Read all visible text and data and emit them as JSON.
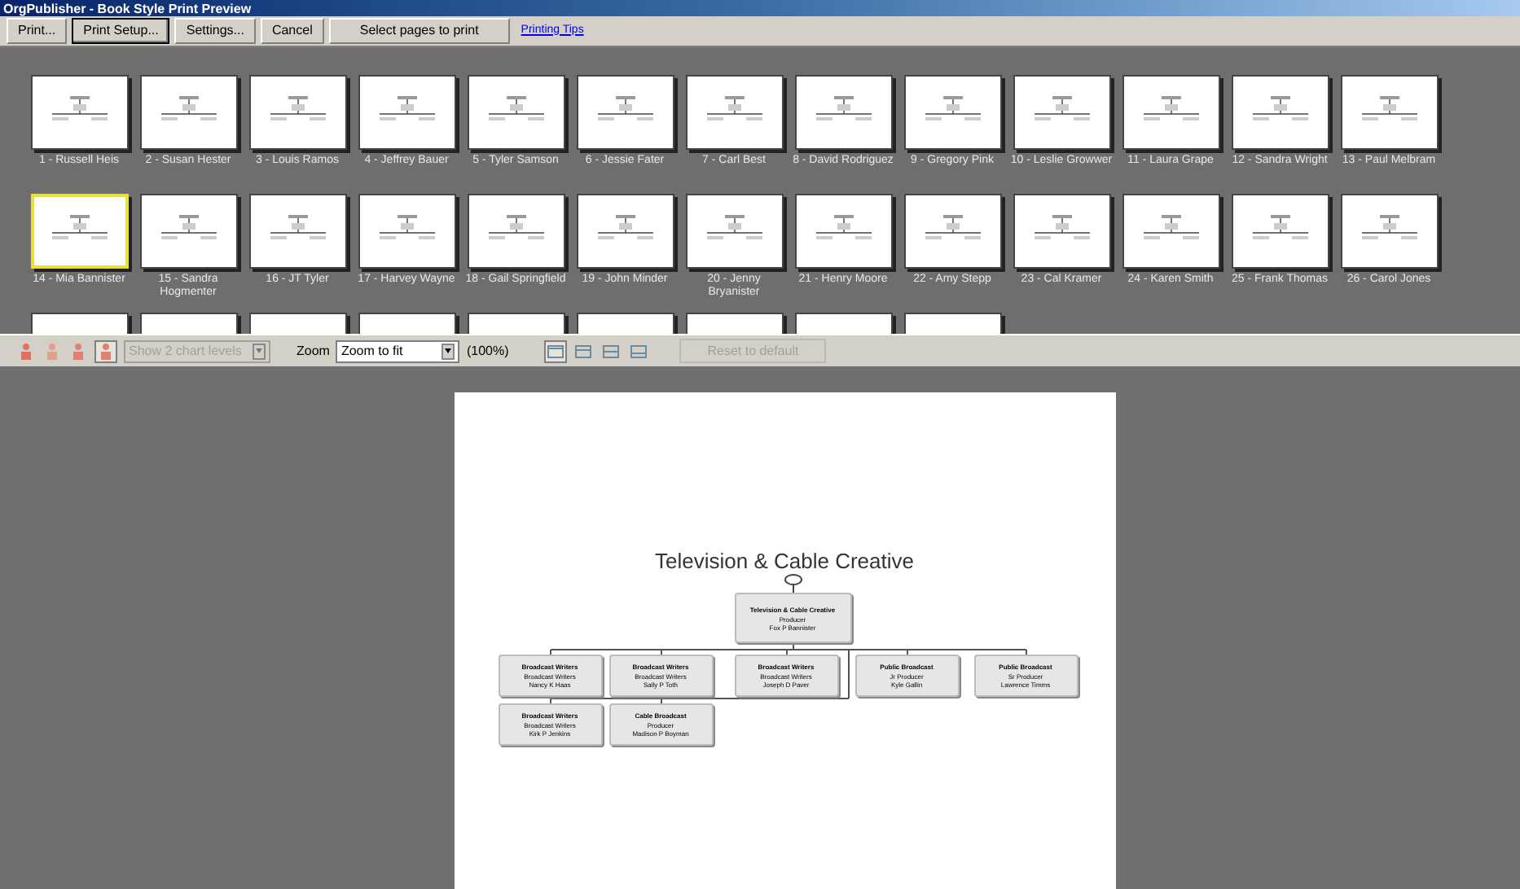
{
  "window": {
    "title": "OrgPublisher - Book Style Print Preview"
  },
  "toolbar": {
    "buttons": [
      {
        "label": "Print...",
        "selected": false
      },
      {
        "label": "Print Setup...",
        "selected": true
      },
      {
        "label": "Settings...",
        "selected": false
      },
      {
        "label": "Cancel",
        "selected": false
      },
      {
        "label": "Select pages to print",
        "selected": false
      }
    ],
    "link": "Printing Tips"
  },
  "thumbnails": [
    {
      "label": "1 - Russell Heis",
      "selected": false
    },
    {
      "label": "2 - Susan Hester",
      "selected": false
    },
    {
      "label": "3 - Louis Ramos",
      "selected": false
    },
    {
      "label": "4 - Jeffrey Bauer",
      "selected": false
    },
    {
      "label": "5 - Tyler Samson",
      "selected": false
    },
    {
      "label": "6 - Jessie Fater",
      "selected": false
    },
    {
      "label": "7 - Carl Best",
      "selected": false
    },
    {
      "label": "8 - David Rodriguez",
      "selected": false
    },
    {
      "label": "9 - Gregory Pink",
      "selected": false
    },
    {
      "label": "10 - Leslie Growwer",
      "selected": false
    },
    {
      "label": "11 - Laura Grape",
      "selected": false
    },
    {
      "label": "12 - Sandra Wright",
      "selected": false
    },
    {
      "label": "13 - Paul Melbram",
      "selected": false
    },
    {
      "label": "14 - Mia Bannister",
      "selected": true
    },
    {
      "label": "15 - Sandra Hogmenter",
      "selected": false
    },
    {
      "label": "16 - JT Tyler",
      "selected": false
    },
    {
      "label": "17 - Harvey Wayne",
      "selected": false
    },
    {
      "label": "18 - Gail Springfield",
      "selected": false
    },
    {
      "label": "19 - John Minder",
      "selected": false
    },
    {
      "label": "20 - Jenny Bryanister",
      "selected": false
    },
    {
      "label": "21 - Henry Moore",
      "selected": false
    },
    {
      "label": "22 - Amy Stepp",
      "selected": false
    },
    {
      "label": "23 - Cal Kramer",
      "selected": false
    },
    {
      "label": "24 - Karen Smith",
      "selected": false
    },
    {
      "label": "25 - Frank Thomas",
      "selected": false
    },
    {
      "label": "26 - Carol Jones",
      "selected": false
    }
  ],
  "partial_thumbnails": [
    {
      "selected": false
    },
    {
      "selected": false
    },
    {
      "selected": false
    },
    {
      "selected": false
    },
    {
      "selected": false
    },
    {
      "selected": false
    },
    {
      "selected": false
    },
    {
      "selected": false
    },
    {
      "selected": false
    }
  ],
  "view_toolbar": {
    "levels": {
      "value": "Show 2 chart levels",
      "disabled": true
    },
    "zoom_label": "Zoom",
    "zoom": "Zoom to fit",
    "zoom_percent": "(100%)",
    "layouts": [
      {
        "selected": true
      },
      {
        "selected": false
      },
      {
        "selected": false
      },
      {
        "selected": false
      }
    ],
    "reset": {
      "label": "Reset to default",
      "disabled": true
    }
  },
  "preview": {
    "title": "Television & Cable Creative",
    "root": {
      "title": "Television & Cable Creative",
      "position": "Producer",
      "name": "Fox P Bannister"
    },
    "row_1": [
      {
        "title": "Broadcast Writers",
        "position": "Broadcast Writers",
        "name": "Nancy K Haas"
      },
      {
        "title": "Broadcast Writers",
        "position": "Broadcast Writers",
        "name": "Sally P Toth"
      },
      {
        "title": "Broadcast Writers",
        "position": "Broadcast Writers",
        "name": "Joseph D Paver"
      },
      {
        "title": "Public Broadcast",
        "position": "Jr Producer",
        "name": "Kyle Gallin"
      },
      {
        "title": "Public Broadcast",
        "position": "Sr Producer",
        "name": "Lawrence Timms"
      }
    ],
    "row_2": [
      {
        "title": "Broadcast Writers",
        "position": "Broadcast Writers",
        "name": "Kirk P Jenkins"
      },
      {
        "title": "Cable Broadcast",
        "position": "Producer",
        "name": "Madison P Boyman"
      }
    ]
  }
}
